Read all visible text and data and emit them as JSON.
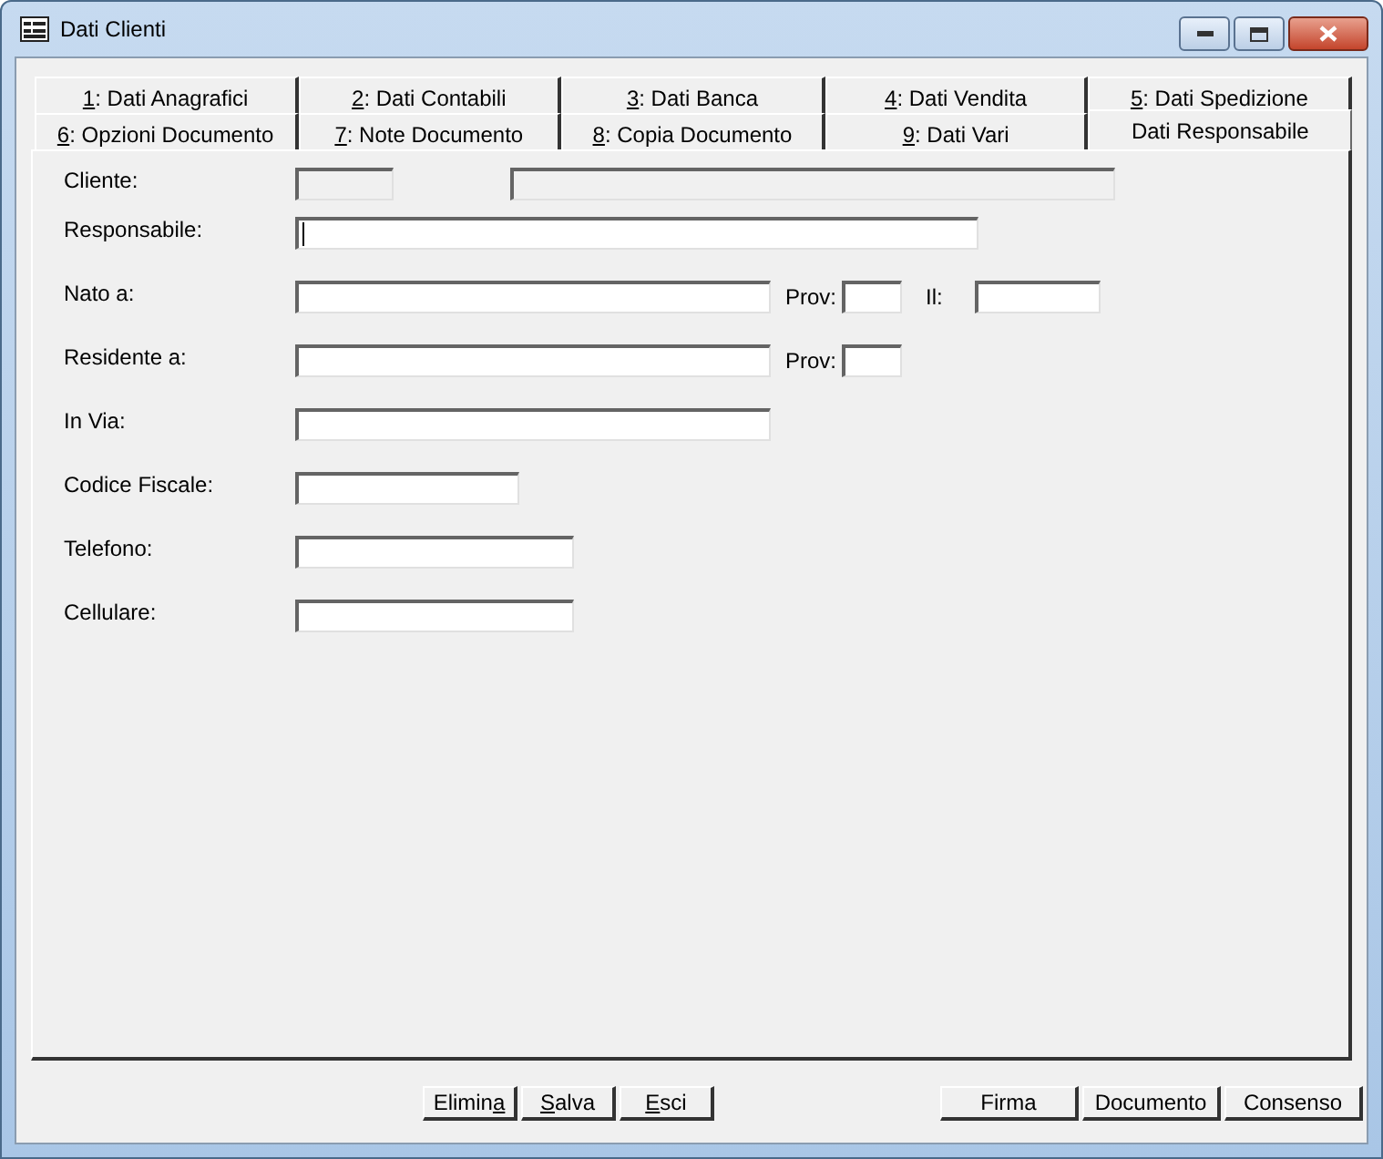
{
  "window": {
    "title": "Dati Clienti"
  },
  "tab_rows": [
    [
      {
        "key": "1",
        "label": ": Dati Anagrafici",
        "selected": false
      },
      {
        "key": "2",
        "label": ": Dati Contabili",
        "selected": false
      },
      {
        "key": "3",
        "label": ": Dati Banca",
        "selected": false
      },
      {
        "key": "4",
        "label": ": Dati Vendita",
        "selected": false
      },
      {
        "key": "5",
        "label": ": Dati Spedizione",
        "selected": false
      }
    ],
    [
      {
        "key": "6",
        "label": ": Opzioni Documento",
        "selected": false
      },
      {
        "key": "7",
        "label": ": Note Documento",
        "selected": false
      },
      {
        "key": "8",
        "label": ": Copia Documento",
        "selected": false
      },
      {
        "key": "9",
        "label": ": Dati Vari",
        "selected": false
      },
      {
        "label": "Dati Responsabile",
        "selected": true
      }
    ]
  ],
  "form": [
    {
      "label": "Cliente:",
      "fields": [
        {
          "kind": "field",
          "disabled": true
        },
        {
          "kind": "field",
          "disabled": true
        }
      ]
    },
    {
      "label": "Responsabile:",
      "fields": [
        {
          "kind": "field",
          "disabled": false,
          "focused": true
        }
      ]
    },
    {
      "label": "Nato a:",
      "fields": [
        {
          "kind": "field",
          "disabled": false
        },
        {
          "kind": "label",
          "text": "Prov:"
        },
        {
          "kind": "field",
          "disabled": false
        },
        {
          "kind": "label",
          "text": "Il:"
        },
        {
          "kind": "field",
          "disabled": false
        }
      ]
    },
    {
      "label": "Residente a:",
      "fields": [
        {
          "kind": "field",
          "disabled": false
        },
        {
          "kind": "label",
          "text": "Prov:"
        },
        {
          "kind": "field",
          "disabled": false
        }
      ]
    },
    {
      "label": "In Via:",
      "fields": [
        {
          "kind": "field",
          "disabled": false
        }
      ]
    },
    {
      "label": "Codice Fiscale:",
      "fields": [
        {
          "kind": "field",
          "disabled": false
        }
      ]
    },
    {
      "label": "Telefono:",
      "fields": [
        {
          "kind": "field",
          "disabled": false
        }
      ]
    },
    {
      "label": "Cellulare:",
      "fields": [
        {
          "kind": "field",
          "disabled": false
        }
      ]
    }
  ],
  "left_buttons": [
    {
      "pre": "Elimin",
      "key": "a"
    },
    {
      "key": "S",
      "post": "alva"
    },
    {
      "key": "E",
      "post": "sci"
    }
  ],
  "right_buttons": [
    {
      "pre": "Firma"
    },
    {
      "pre": "Documento"
    },
    {
      "pre": "Consenso"
    }
  ]
}
